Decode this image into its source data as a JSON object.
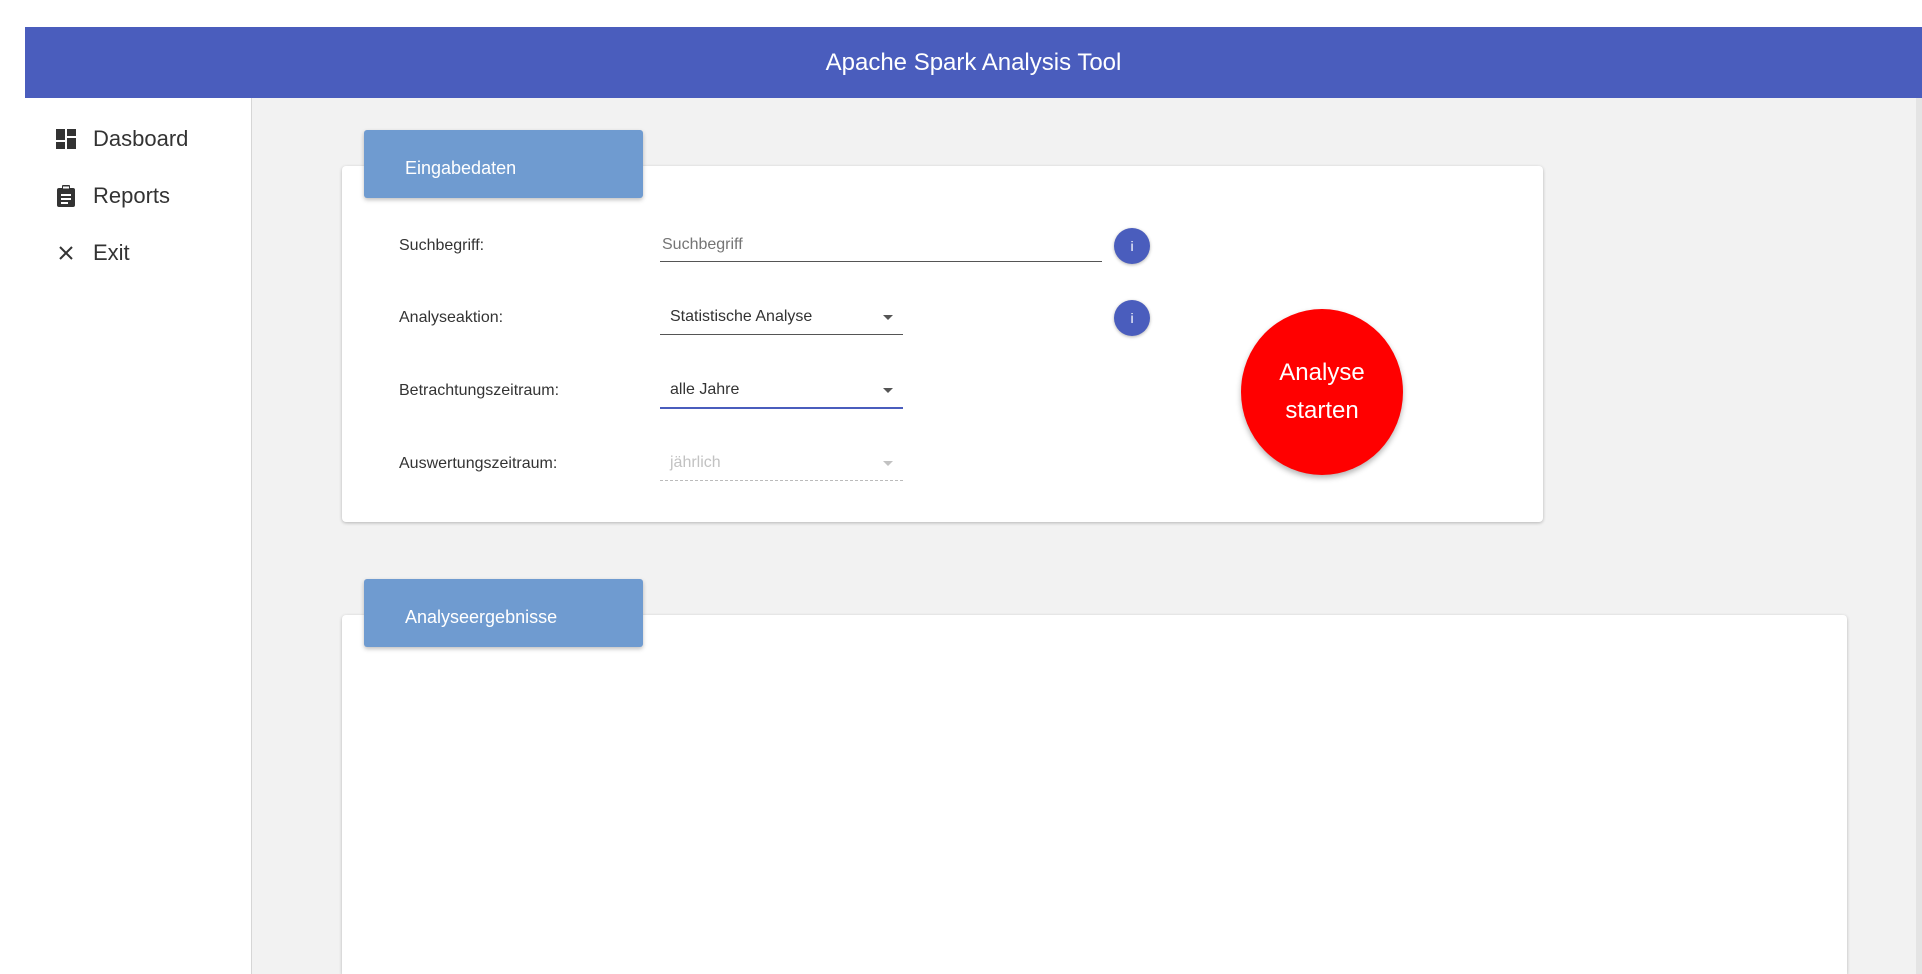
{
  "app": {
    "title": "Apache Spark Analysis Tool"
  },
  "sidebar": {
    "items": [
      {
        "label": "Dasboard",
        "icon": "dashboard-icon"
      },
      {
        "label": "Reports",
        "icon": "clipboard-icon"
      },
      {
        "label": "Exit",
        "icon": "close-icon"
      }
    ]
  },
  "input_card": {
    "title": "Eingabedaten",
    "search": {
      "label": "Suchbegriff:",
      "placeholder": "Suchbegriff",
      "value": ""
    },
    "action": {
      "label": "Analyseaktion:",
      "value": "Statistische Analyse"
    },
    "period": {
      "label": "Betrachtungszeitraum:",
      "value": "alle Jahre"
    },
    "evaluation": {
      "label": "Auswertungszeitraum:",
      "value": "jährlich"
    },
    "info_label": "i",
    "start_button": {
      "line1": "Analyse",
      "line2": "starten"
    }
  },
  "results_card": {
    "title": "Analyseergebnisse"
  },
  "colors": {
    "toolbar": "#4a5dbd",
    "card_header": "#6f9bd0",
    "start_button": "#ff0000",
    "info_button": "#4a5dbd"
  }
}
